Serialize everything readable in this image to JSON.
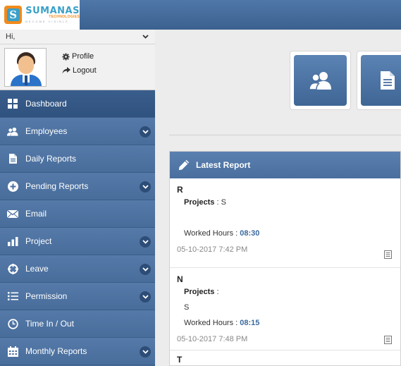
{
  "brand": {
    "name": "SUMANAS",
    "sub": "TECHNOLOGIES",
    "tagline": "BECOME VISIBLE"
  },
  "user": {
    "greeting": "Hi,",
    "profile_label": "Profile",
    "logout_label": "Logout"
  },
  "sidebar": {
    "items": [
      {
        "label": "Dashboard",
        "icon": "dashboard-icon",
        "expandable": false,
        "active": true
      },
      {
        "label": "Employees",
        "icon": "users-icon",
        "expandable": true
      },
      {
        "label": "Daily Reports",
        "icon": "file-icon",
        "expandable": false
      },
      {
        "label": "Pending Reports",
        "icon": "plus-circle-icon",
        "expandable": true
      },
      {
        "label": "Email",
        "icon": "envelope-icon",
        "expandable": false
      },
      {
        "label": "Project",
        "icon": "bar-chart-icon",
        "expandable": true
      },
      {
        "label": "Leave",
        "icon": "crosshair-icon",
        "expandable": true
      },
      {
        "label": "Permission",
        "icon": "list-icon",
        "expandable": true
      },
      {
        "label": "Time In / Out",
        "icon": "clock-icon",
        "expandable": false
      },
      {
        "label": "Monthly Reports",
        "icon": "calendar-icon",
        "expandable": true
      }
    ]
  },
  "tiles": [
    {
      "icon": "users-icon"
    },
    {
      "icon": "document-icon"
    }
  ],
  "panel": {
    "title": "Latest Report",
    "reports": [
      {
        "name": "R",
        "projects_label": "Projects",
        "projects_value": "S",
        "hours_label": "Worked Hours",
        "hours": "08:30",
        "time": "05-10-2017 7:42 PM"
      },
      {
        "name": "N",
        "projects_label": "Projects",
        "projects_value": "S",
        "hours_label": "Worked Hours",
        "hours": "08:15",
        "time": "05-10-2017 7:48 PM"
      },
      {
        "name": "T"
      }
    ]
  },
  "colors": {
    "primary": "#4a6f9e",
    "active_nav": "#34577f",
    "accent": "#3c6b9e",
    "logo_orange": "#f08a1c",
    "logo_blue": "#3aa0c8"
  }
}
